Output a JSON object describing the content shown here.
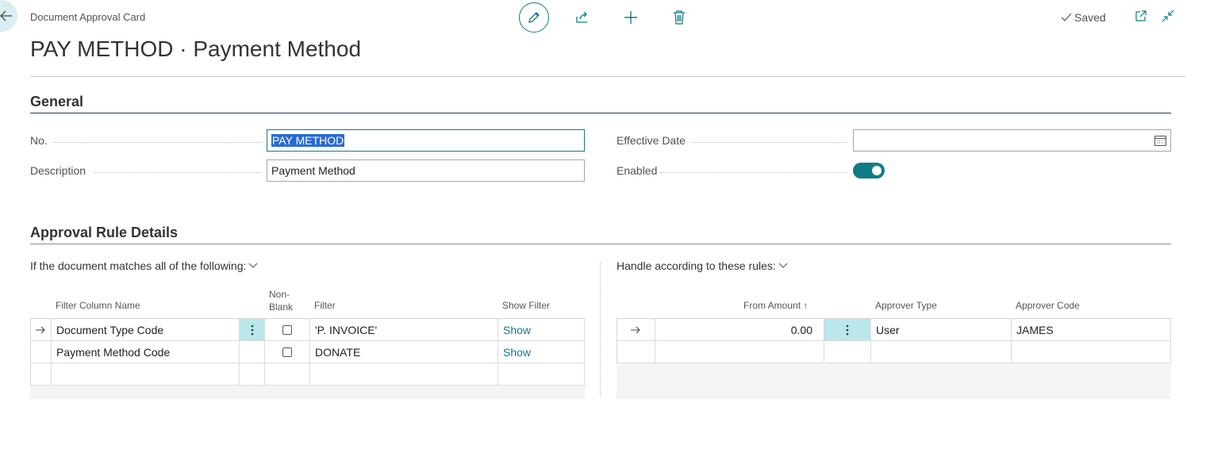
{
  "window": {
    "caption": "Document Approval Card",
    "title": "PAY METHOD · Payment Method",
    "saved_label": "Saved"
  },
  "actions": {
    "icons": [
      "edit-icon",
      "share-icon",
      "new-icon",
      "delete-icon",
      "open-new-window-icon",
      "collapse-icon"
    ]
  },
  "general": {
    "title": "General",
    "no_label": "No.",
    "no_value": "PAY METHOD",
    "description_label": "Description",
    "description_value": "Payment Method",
    "effective_date_label": "Effective Date",
    "effective_date_value": "",
    "enabled_label": "Enabled",
    "enabled": true
  },
  "approval": {
    "title": "Approval Rule Details",
    "conditions_caption": "If the document matches all of the following:",
    "rules_caption": "Handle according to these rules:",
    "conditions": {
      "headers": {
        "filter_column_name": "Filter Column Name",
        "non_blank_1": "Non-",
        "non_blank_2": "Blank",
        "filter": "Filter",
        "show_filter": "Show Filter"
      },
      "rows": [
        {
          "name": "Document Type Code",
          "non_blank": false,
          "filter": "'P. INVOICE'",
          "show": "Show"
        },
        {
          "name": "Payment Method Code",
          "non_blank": false,
          "filter": "DONATE",
          "show": "Show"
        }
      ]
    },
    "rules": {
      "headers": {
        "from_amount": "From Amount",
        "sort_indicator": "↑",
        "approver_type": "Approver Type",
        "approver_code": "Approver Code"
      },
      "rows": [
        {
          "from_amount": "0.00",
          "approver_type": "User",
          "approver_code": "JAMES"
        }
      ]
    }
  },
  "colors": {
    "accent": "#0f7b85",
    "selected_cell": "#b9e7ea",
    "section_rule": "#1f3a5f"
  }
}
